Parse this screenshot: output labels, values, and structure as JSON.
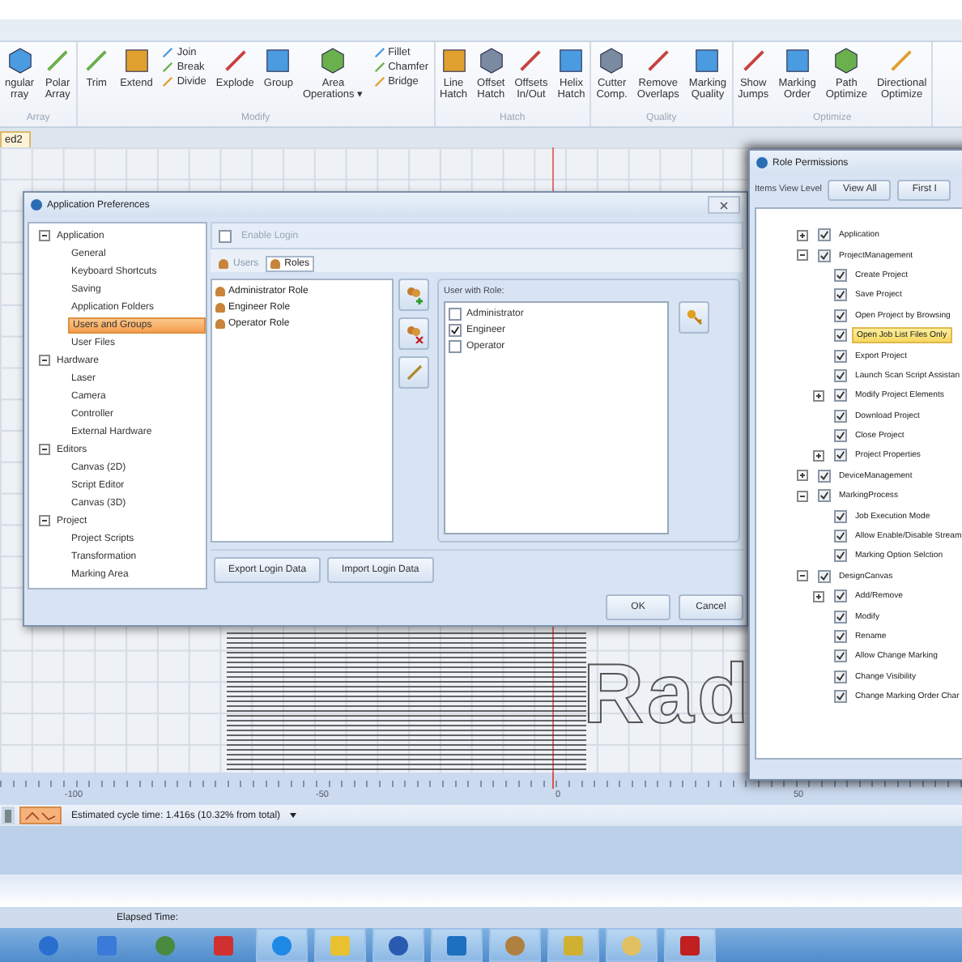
{
  "ribbon": {
    "groups": [
      {
        "label": "Array",
        "items": [
          {
            "kind": "large",
            "label": "ngular\nrray"
          },
          {
            "kind": "large",
            "label": "Polar\nArray"
          }
        ]
      },
      {
        "label": "Modify",
        "items": [
          {
            "kind": "large",
            "label": "Trim"
          },
          {
            "kind": "large",
            "label": "Extend"
          },
          {
            "kind": "stack",
            "labels": [
              "Join",
              "Break",
              "Divide"
            ]
          },
          {
            "kind": "large",
            "label": "Explode"
          },
          {
            "kind": "large",
            "label": "Group"
          },
          {
            "kind": "large",
            "label": "Area\nOperations ▾"
          },
          {
            "kind": "stack",
            "labels": [
              "Fillet",
              "Chamfer",
              "Bridge"
            ]
          }
        ]
      },
      {
        "label": "Hatch",
        "items": [
          {
            "kind": "large",
            "label": "Line\nHatch"
          },
          {
            "kind": "large",
            "label": "Offset\nHatch"
          },
          {
            "kind": "large",
            "label": "Offsets\nIn/Out"
          },
          {
            "kind": "large",
            "label": "Helix\nHatch"
          }
        ]
      },
      {
        "label": "Quality",
        "items": [
          {
            "kind": "large",
            "label": "Cutter\nComp."
          },
          {
            "kind": "large",
            "label": "Remove\nOverlaps"
          },
          {
            "kind": "large",
            "label": "Marking\nQuality"
          }
        ]
      },
      {
        "label": "Optimize",
        "items": [
          {
            "kind": "large",
            "label": "Show\nJumps"
          },
          {
            "kind": "large",
            "label": "Marking\nOrder"
          },
          {
            "kind": "large",
            "label": "Path\nOptimize"
          },
          {
            "kind": "large",
            "label": "Directional\nOptimize"
          }
        ]
      }
    ]
  },
  "document_tab": {
    "label": "ed2"
  },
  "canvas": {
    "text": "Rad"
  },
  "preferences": {
    "title": "Application Preferences",
    "tree": [
      {
        "label": "Application",
        "expanded": true,
        "children": [
          {
            "label": "General",
            "selected": false
          },
          {
            "label": "Keyboard Shortcuts",
            "selected": false
          },
          {
            "label": "Saving",
            "selected": false
          },
          {
            "label": "Application Folders",
            "selected": false
          },
          {
            "label": "Users and Groups",
            "selected": true
          },
          {
            "label": "User Files",
            "selected": false
          }
        ]
      },
      {
        "label": "Hardware",
        "expanded": true,
        "children": [
          {
            "label": "Laser",
            "selected": false
          },
          {
            "label": "Camera",
            "selected": false
          },
          {
            "label": "Controller",
            "selected": false
          },
          {
            "label": "External Hardware",
            "selected": false
          }
        ]
      },
      {
        "label": "Editors",
        "expanded": true,
        "children": [
          {
            "label": "Canvas (2D)",
            "selected": false
          },
          {
            "label": "Script Editor",
            "selected": false
          },
          {
            "label": "Canvas (3D)",
            "selected": false
          }
        ]
      },
      {
        "label": "Project",
        "expanded": true,
        "children": [
          {
            "label": "Project Scripts",
            "selected": false
          },
          {
            "label": "Transformation",
            "selected": false
          },
          {
            "label": "Marking Area",
            "selected": false
          }
        ]
      }
    ],
    "enable_login": {
      "label": "Enable Login",
      "checked": false,
      "disabled": true
    },
    "tabs": [
      {
        "label": "Users",
        "selected": false
      },
      {
        "label": "Roles",
        "selected": true
      }
    ],
    "roles": [
      "Administrator Role",
      "Engineer Role",
      "Operator Role"
    ],
    "user_with_role": {
      "label": "User with Role:",
      "users": [
        {
          "label": "Administrator",
          "checked": false
        },
        {
          "label": "Engineer",
          "checked": true
        },
        {
          "label": "Operator",
          "checked": false
        }
      ]
    },
    "buttons": [
      "Export Login Data",
      "Import Login Data"
    ],
    "footer_buttons": [
      "OK",
      "Cancel"
    ]
  },
  "role_permissions": {
    "title": "Role Permissions",
    "view_level_label": "Items View Level",
    "view_buttons": [
      "View All",
      "First I"
    ],
    "tree": [
      {
        "label": "Application",
        "checked": true,
        "expanded": false,
        "selected": false
      },
      {
        "label": "ProjectManagement",
        "checked": true,
        "expanded": true,
        "selected": false,
        "children": [
          {
            "label": "Create Project",
            "checked": true,
            "selected": false
          },
          {
            "label": "Save Project",
            "checked": true,
            "selected": false
          },
          {
            "label": "Open Project by Browsing",
            "checked": true,
            "selected": false
          },
          {
            "label": "Open Job List Files Only",
            "checked": true,
            "selected": true
          },
          {
            "label": "Export Project",
            "checked": true,
            "selected": false
          },
          {
            "label": "Launch Scan Script Assistan",
            "checked": true,
            "selected": false
          },
          {
            "label": "Modify Project Elements",
            "checked": true,
            "expanded": false,
            "selected": false
          },
          {
            "label": "Download Project",
            "checked": true,
            "selected": false
          },
          {
            "label": "Close Project",
            "checked": true,
            "selected": false
          },
          {
            "label": "Project Properties",
            "checked": true,
            "expanded": false,
            "selected": false
          }
        ]
      },
      {
        "label": "DeviceManagement",
        "checked": true,
        "expanded": false,
        "selected": false
      },
      {
        "label": "MarkingProcess",
        "checked": true,
        "expanded": true,
        "selected": false,
        "children": [
          {
            "label": "Job Execution Mode",
            "checked": true,
            "selected": false
          },
          {
            "label": "Allow Enable/Disable Stream",
            "checked": true,
            "selected": false
          },
          {
            "label": "Marking Option Selction",
            "checked": true,
            "selected": false
          }
        ]
      },
      {
        "label": "DesignCanvas",
        "checked": true,
        "expanded": true,
        "selected": false,
        "children": [
          {
            "label": "Add/Remove",
            "checked": true,
            "expanded": false,
            "selected": false
          },
          {
            "label": "Modify",
            "checked": true,
            "selected": false
          },
          {
            "label": "Rename",
            "checked": true,
            "selected": false
          },
          {
            "label": "Allow Change Marking",
            "checked": true,
            "selected": false
          },
          {
            "label": "Change Visibility",
            "checked": true,
            "selected": false
          },
          {
            "label": "Change Marking Order Char",
            "checked": true,
            "selected": false
          }
        ]
      }
    ]
  },
  "ruler": {
    "labels": [
      "-100",
      "-50",
      "0",
      "50"
    ]
  },
  "status_bar": {
    "text": "Estimated cycle time: 1.416s (10.32% from total)"
  },
  "elapsed": {
    "label": "Elapsed Time:"
  },
  "taskbar": {
    "buttons": [
      {
        "highlighted": false
      },
      {
        "highlighted": false
      },
      {
        "highlighted": false
      },
      {
        "highlighted": false
      },
      {
        "highlighted": true
      },
      {
        "highlighted": true
      },
      {
        "highlighted": true
      },
      {
        "highlighted": true
      },
      {
        "highlighted": true
      },
      {
        "highlighted": true
      },
      {
        "highlighted": true
      },
      {
        "highlighted": true
      }
    ]
  }
}
